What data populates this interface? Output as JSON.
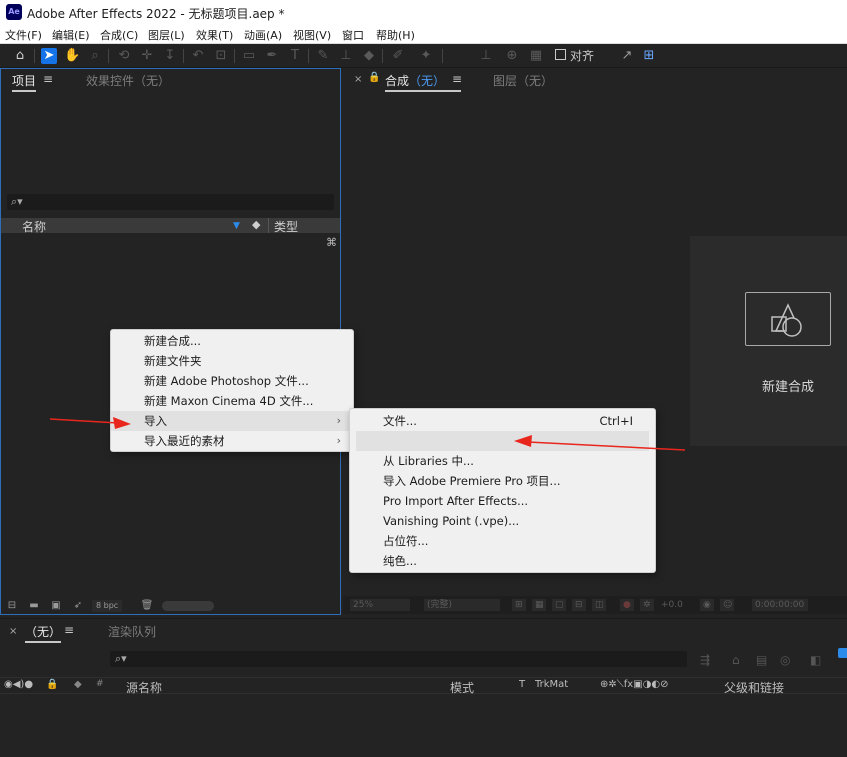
{
  "window": {
    "title": "Adobe After Effects 2022 - 无标题项目.aep *",
    "app_icon_text": "Ae"
  },
  "menubar": [
    "文件(F)",
    "编辑(E)",
    "合成(C)",
    "图层(L)",
    "效果(T)",
    "动画(A)",
    "视图(V)",
    "窗口",
    "帮助(H)"
  ],
  "toolbar": {
    "snap_label": "对齐"
  },
  "project_panel": {
    "tab_project": "项目",
    "tab_effects": "效果控件（无）",
    "col_name": "名称",
    "col_type": "类型",
    "bpc": "8 bpc"
  },
  "comp_panel": {
    "tab_comp": "合成",
    "tab_comp_value": "（无）",
    "tab_layer": "图层（无）",
    "new_comp_label": "新建合成",
    "zoom": "25%",
    "quality": "(完整)",
    "exposure": "+0.0",
    "timecode": "0:00:00:00"
  },
  "timeline": {
    "tab_none": "（无）",
    "tab_render": "渲染队列",
    "col_source": "源名称",
    "col_mode": "模式",
    "col_t": "T",
    "col_trkmat": "TrkMat",
    "col_parent": "父级和链接"
  },
  "context_menu": {
    "items": [
      "新建合成...",
      "新建文件夹",
      "新建 Adobe Photoshop 文件...",
      "新建 Maxon Cinema 4D 文件...",
      "导入",
      "导入最近的素材"
    ]
  },
  "submenu": {
    "items": [
      {
        "label": "文件...",
        "shortcut": "Ctrl+I"
      },
      {
        "label": "",
        "shortcut": ""
      },
      {
        "label": "从 Libraries 中...",
        "shortcut": ""
      },
      {
        "label": "导入 Adobe Premiere Pro 项目...",
        "shortcut": ""
      },
      {
        "label": "Pro Import After Effects...",
        "shortcut": ""
      },
      {
        "label": "Vanishing Point (.vpe)...",
        "shortcut": ""
      },
      {
        "label": "占位符...",
        "shortcut": ""
      },
      {
        "label": "纯色...",
        "shortcut": ""
      }
    ]
  },
  "colors": {
    "accent_blue": "#1473e6",
    "annotation_red": "#e8261c",
    "panel_focus_border": "#2f6eb8"
  }
}
